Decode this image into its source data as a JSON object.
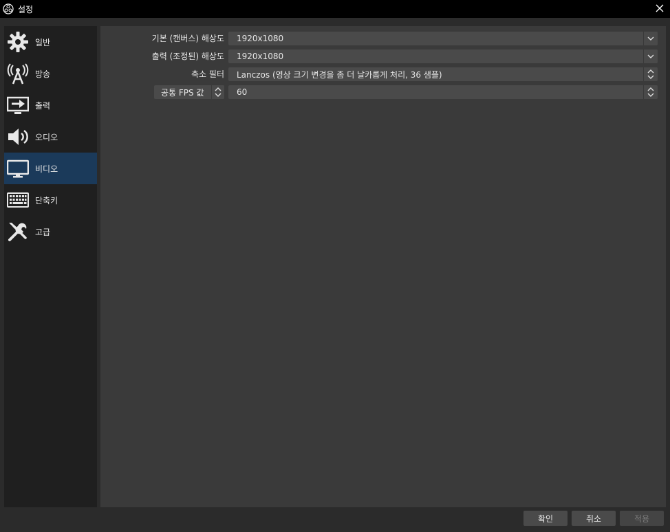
{
  "window": {
    "title": "설정"
  },
  "sidebar": {
    "items": [
      {
        "label": "일반",
        "icon": "gear-icon"
      },
      {
        "label": "방송",
        "icon": "broadcast-antenna-icon"
      },
      {
        "label": "출력",
        "icon": "output-monitor-icon"
      },
      {
        "label": "오디오",
        "icon": "speaker-icon"
      },
      {
        "label": "비디오",
        "icon": "monitor-icon",
        "active": true
      },
      {
        "label": "단축키",
        "icon": "keyboard-icon"
      },
      {
        "label": "고급",
        "icon": "wrench-screwdriver-icon"
      }
    ]
  },
  "video": {
    "base_resolution": {
      "label": "기본 (캔버스) 해상도",
      "value": "1920x1080"
    },
    "output_resolution": {
      "label": "출력 (조정된) 해상도",
      "value": "1920x1080"
    },
    "downscale_filter": {
      "label": "축소 필터",
      "value": "Lanczos (영상 크기 변경을 좀 더 날카롭게 처리, 36 샘플)"
    },
    "fps": {
      "type_label": "공통 FPS 값",
      "value": "60"
    }
  },
  "buttons": {
    "ok": "확인",
    "cancel": "취소",
    "apply": "적용"
  },
  "colors": {
    "accent_active": "#1b3a5a",
    "sidebar_bg": "#1f1f1f",
    "content_bg": "#3a3a3a"
  }
}
